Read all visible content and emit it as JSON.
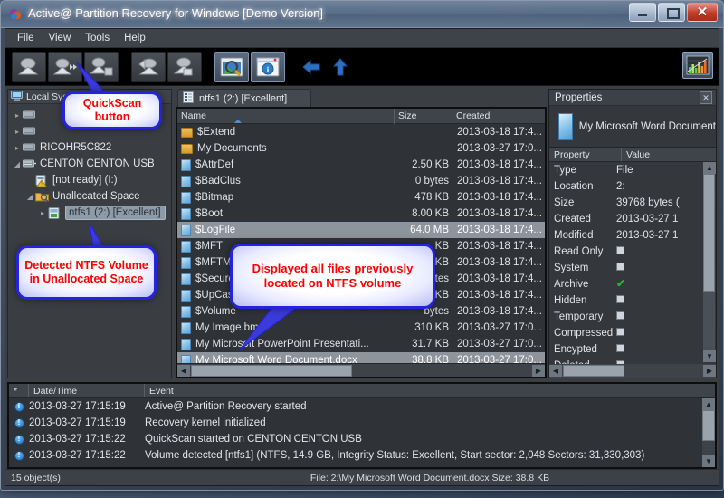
{
  "window": {
    "title": "Active@ Partition Recovery for Windows [Demo Version]",
    "app_icon": "app-icon",
    "minimize_label": "–",
    "maximize_label": "□",
    "close_label": "✕"
  },
  "menubar": {
    "items": [
      "File",
      "View",
      "Tools",
      "Help"
    ]
  },
  "toolbar": {
    "buttons": [
      {
        "name": "quickscan-button",
        "icon": "scan-disk-icon"
      },
      {
        "name": "superscan-button",
        "icon": "scan-fast-icon"
      },
      {
        "name": "save-scan-button",
        "icon": "scan-save-icon"
      },
      {
        "name": "recover-button",
        "icon": "recover-icon"
      },
      {
        "name": "save-button",
        "icon": "save-icon"
      },
      {
        "name": "preview-button",
        "icon": "preview-magnifier-icon"
      },
      {
        "name": "properties-button",
        "icon": "info-window-icon"
      },
      {
        "name": "back-button",
        "icon": "arrow-left-icon"
      },
      {
        "name": "up-button",
        "icon": "arrow-up-icon"
      }
    ],
    "chart_button": "bar-chart-icon"
  },
  "left_pane": {
    "header": "Local System Devices",
    "header_icon": "computer-icon",
    "nodes": [
      {
        "label": "",
        "icon": "device-icon",
        "indent": 0,
        "arrow": "▸",
        "selected": false,
        "hidden_by_callout": true
      },
      {
        "label": "",
        "icon": "device-icon",
        "indent": 0,
        "arrow": "▸",
        "selected": false,
        "hidden_by_callout": true
      },
      {
        "label": "RICOHR5C822",
        "icon": "device-icon",
        "indent": 0,
        "arrow": "▸",
        "selected": false
      },
      {
        "label": "CENTON  CENTON USB",
        "icon": "usb-icon",
        "indent": 0,
        "arrow": "◢",
        "selected": false
      },
      {
        "label": "[not ready] (I:)",
        "icon": "drive-warn-icon",
        "indent": 1,
        "arrow": "",
        "selected": false
      },
      {
        "label": "Unallocated Space",
        "icon": "unallocated-icon",
        "indent": 1,
        "arrow": "◢",
        "selected": false
      },
      {
        "label": "ntfs1 (2:) [Excellent]",
        "icon": "volume-icon",
        "indent": 2,
        "arrow": "▸",
        "selected": true
      }
    ]
  },
  "center_pane": {
    "tab": {
      "label": "ntfs1 (2:) [Excellent]",
      "icon": "volume-list-icon"
    },
    "columns": [
      "Name",
      "Size",
      "Created"
    ],
    "sort_column": "Name",
    "rows": [
      {
        "name": "$Extend",
        "icon": "folder-icon",
        "size": "",
        "created": "2013-03-18 17:4...",
        "state": "normal"
      },
      {
        "name": "My Documents",
        "icon": "folder-icon",
        "size": "",
        "created": "2013-03-27 17:0...",
        "state": "normal"
      },
      {
        "name": "$AttrDef",
        "icon": "file-icon",
        "size": "2.50 KB",
        "created": "2013-03-18 17:4...",
        "state": "normal"
      },
      {
        "name": "$BadClus",
        "icon": "file-icon",
        "size": "0 bytes",
        "created": "2013-03-18 17:4...",
        "state": "normal"
      },
      {
        "name": "$Bitmap",
        "icon": "file-icon",
        "size": "478 KB",
        "created": "2013-03-18 17:4...",
        "state": "normal"
      },
      {
        "name": "$Boot",
        "icon": "file-icon",
        "size": "8.00 KB",
        "created": "2013-03-18 17:4...",
        "state": "normal"
      },
      {
        "name": "$LogFile",
        "icon": "file-icon",
        "size": "64.0 MB",
        "created": "2013-03-18 17:4...",
        "state": "hover"
      },
      {
        "name": "$MFT",
        "icon": "file-icon",
        "size": "KB",
        "created": "2013-03-18 17:4...",
        "state": "normal"
      },
      {
        "name": "$MFTMirr",
        "icon": "file-icon",
        "size": "KB",
        "created": "2013-03-18 17:4...",
        "state": "normal"
      },
      {
        "name": "$Secure",
        "icon": "file-icon",
        "size": "bytes",
        "created": "2013-03-18 17:4...",
        "state": "normal"
      },
      {
        "name": "$UpCase",
        "icon": "file-icon",
        "size": "KB",
        "created": "2013-03-18 17:4...",
        "state": "normal"
      },
      {
        "name": "$Volume",
        "icon": "file-icon",
        "size": "bytes",
        "created": "2013-03-18 17:4...",
        "state": "normal"
      },
      {
        "name": "My Image.bmp",
        "icon": "file-icon",
        "size": "310 KB",
        "created": "2013-03-27 17:0...",
        "state": "normal"
      },
      {
        "name": "My Microsoft PowerPoint Presentati...",
        "icon": "file-icon",
        "size": "31.7 KB",
        "created": "2013-03-27 17:0...",
        "state": "normal"
      },
      {
        "name": "My Microsoft Word Document.docx",
        "icon": "file-icon",
        "size": "38.8 KB",
        "created": "2013-03-27 17:0...",
        "state": "selected"
      }
    ]
  },
  "right_pane": {
    "title": "Properties",
    "close_label": "✕",
    "file_name": "My Microsoft Word Document",
    "file_icon": "document-icon",
    "columns": [
      "Property",
      "Value"
    ],
    "rows": [
      {
        "key": "Type",
        "value": "File",
        "type": "text"
      },
      {
        "key": "Location",
        "value": "2:",
        "type": "text"
      },
      {
        "key": "Size",
        "value": "39768 bytes (",
        "type": "text"
      },
      {
        "key": "Created",
        "value": "2013-03-27 1",
        "type": "text"
      },
      {
        "key": "Modified",
        "value": "2013-03-27 1",
        "type": "text"
      },
      {
        "key": "Read Only",
        "value": "",
        "type": "checkbox",
        "checked": false
      },
      {
        "key": "System",
        "value": "",
        "type": "checkbox",
        "checked": false
      },
      {
        "key": "Archive",
        "value": "",
        "type": "checkbox",
        "checked": true
      },
      {
        "key": "Hidden",
        "value": "",
        "type": "checkbox",
        "checked": false
      },
      {
        "key": "Temporary",
        "value": "",
        "type": "checkbox",
        "checked": false
      },
      {
        "key": "Compressed",
        "value": "",
        "type": "checkbox",
        "checked": false
      },
      {
        "key": "Encypted",
        "value": "",
        "type": "checkbox",
        "checked": false
      },
      {
        "key": "Deleted",
        "value": "",
        "type": "checkbox",
        "checked": false
      }
    ]
  },
  "log_pane": {
    "columns": [
      "*",
      "Date/Time",
      "Event"
    ],
    "rows": [
      {
        "icon": "info-icon",
        "datetime": "2013-03-27 17:15:19",
        "event": "Active@ Partition Recovery started"
      },
      {
        "icon": "info-icon",
        "datetime": "2013-03-27 17:15:19",
        "event": "Recovery kernel initialized"
      },
      {
        "icon": "info-icon",
        "datetime": "2013-03-27 17:15:22",
        "event": "QuickScan started on CENTON  CENTON USB"
      },
      {
        "icon": "info-icon",
        "datetime": "2013-03-27 17:15:22",
        "event": "Volume detected [ntfs1] (NTFS, 14.9 GB, Integrity Status: Excellent, Start sector: 2,048 Sectors: 31,330,303)"
      }
    ]
  },
  "statusbar": {
    "objects": "15 object(s)",
    "file_info": "File: 2:\\My Microsoft Word Document.docx  Size: 38.8 KB"
  },
  "callouts": [
    {
      "id": "callout-quickscan",
      "text": "QuickScan button"
    },
    {
      "id": "callout-ntfs-volume",
      "text": "Detected NTFS Volume in Unallocated Space"
    },
    {
      "id": "callout-files-listed",
      "text": "Displayed all files previously located on NTFS volume"
    }
  ],
  "colors": {
    "callout_text": "#ff0000",
    "callout_border": "#2323e0",
    "selection": "#8d949c",
    "check_green": "#2cb22c"
  }
}
